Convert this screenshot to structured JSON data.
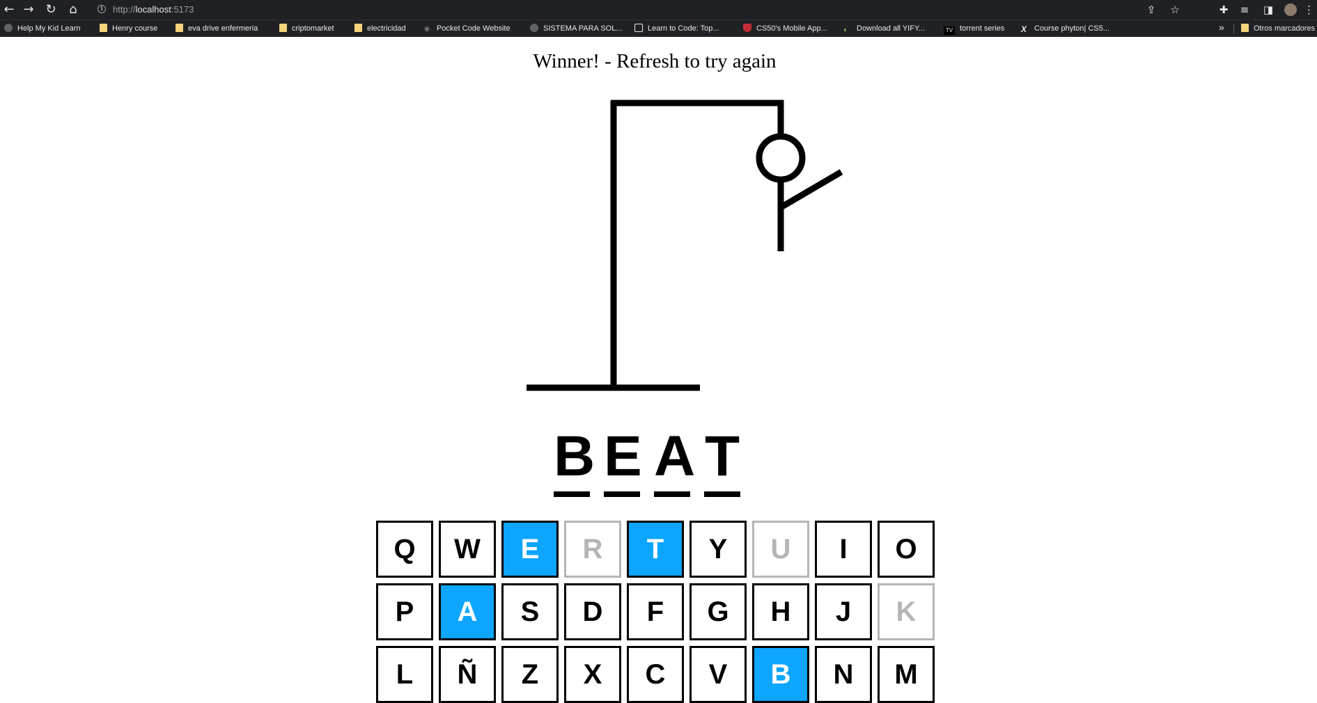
{
  "browser": {
    "url_prefix": "http://",
    "url_host": "localhost",
    "url_port": ":5173",
    "bookmarks": [
      {
        "label": "Help My Kid Learn",
        "icon": "globe"
      },
      {
        "label": "Henry course",
        "icon": "folder"
      },
      {
        "label": "eva drive enfermeria",
        "icon": "folder"
      },
      {
        "label": "criptomarket",
        "icon": "folder"
      },
      {
        "label": "electricidad",
        "icon": "folder"
      },
      {
        "label": "Pocket Code Website",
        "icon": "star"
      },
      {
        "label": "SISTEMA PARA SOL...",
        "icon": "globe"
      },
      {
        "label": "Learn to Code: Top...",
        "icon": "square"
      },
      {
        "label": "CS50's Mobile App...",
        "icon": "shield"
      },
      {
        "label": "Download all YIFY...",
        "icon": "green"
      },
      {
        "label": "torrent series",
        "icon": "tv"
      },
      {
        "label": "Course phyton| CS5...",
        "icon": "x"
      }
    ],
    "overflow_label": "»",
    "other_bookmarks": "Otros marcadores"
  },
  "game": {
    "status": "Winner! - Refresh to try again",
    "word": [
      "B",
      "E",
      "A",
      "T"
    ],
    "keyboard": [
      {
        "key": "Q",
        "state": "unused"
      },
      {
        "key": "W",
        "state": "unused"
      },
      {
        "key": "E",
        "state": "correct"
      },
      {
        "key": "R",
        "state": "wrong"
      },
      {
        "key": "T",
        "state": "correct"
      },
      {
        "key": "Y",
        "state": "unused"
      },
      {
        "key": "U",
        "state": "wrong"
      },
      {
        "key": "I",
        "state": "unused"
      },
      {
        "key": "O",
        "state": "unused"
      },
      {
        "key": "P",
        "state": "unused"
      },
      {
        "key": "A",
        "state": "correct"
      },
      {
        "key": "S",
        "state": "unused"
      },
      {
        "key": "D",
        "state": "unused"
      },
      {
        "key": "F",
        "state": "unused"
      },
      {
        "key": "G",
        "state": "unused"
      },
      {
        "key": "H",
        "state": "unused"
      },
      {
        "key": "J",
        "state": "unused"
      },
      {
        "key": "K",
        "state": "wrong"
      },
      {
        "key": "L",
        "state": "unused"
      },
      {
        "key": "Ñ",
        "state": "unused"
      },
      {
        "key": "Z",
        "state": "unused"
      },
      {
        "key": "X",
        "state": "unused"
      },
      {
        "key": "C",
        "state": "unused"
      },
      {
        "key": "V",
        "state": "unused"
      },
      {
        "key": "B",
        "state": "correct"
      },
      {
        "key": "N",
        "state": "unused"
      },
      {
        "key": "M",
        "state": "unused"
      }
    ],
    "colors": {
      "correct": "#0ea5ff",
      "wrong": "#b5b5b5"
    }
  }
}
